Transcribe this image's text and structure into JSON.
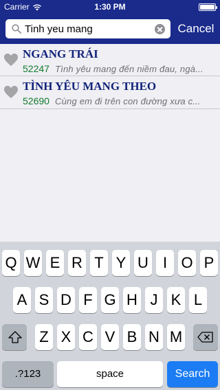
{
  "status": {
    "carrier": "Carrier",
    "time": "1:30 PM"
  },
  "search": {
    "value": "Tinh yeu mang",
    "cancel_label": "Cancel"
  },
  "results": [
    {
      "title": "NGANG TRÁI",
      "code": "52247",
      "lyric": "Tình yêu mang đến niềm đau, ngà..."
    },
    {
      "title": "TÌNH YÊU MANG THEO",
      "code": "52690",
      "lyric": "Cùng em đi trên con đường xưa c..."
    }
  ],
  "keyboard": {
    "row1": [
      "Q",
      "W",
      "E",
      "R",
      "T",
      "Y",
      "U",
      "I",
      "O",
      "P"
    ],
    "row2": [
      "A",
      "S",
      "D",
      "F",
      "G",
      "H",
      "J",
      "K",
      "L"
    ],
    "row3": [
      "Z",
      "X",
      "C",
      "V",
      "B",
      "N",
      "M"
    ],
    "numbers_label": ".?123",
    "space_label": "space",
    "search_label": "Search"
  },
  "colors": {
    "header": "#1a2b8c",
    "title": "#12237a",
    "code": "#137a2a",
    "search_key": "#1c7cf4"
  }
}
